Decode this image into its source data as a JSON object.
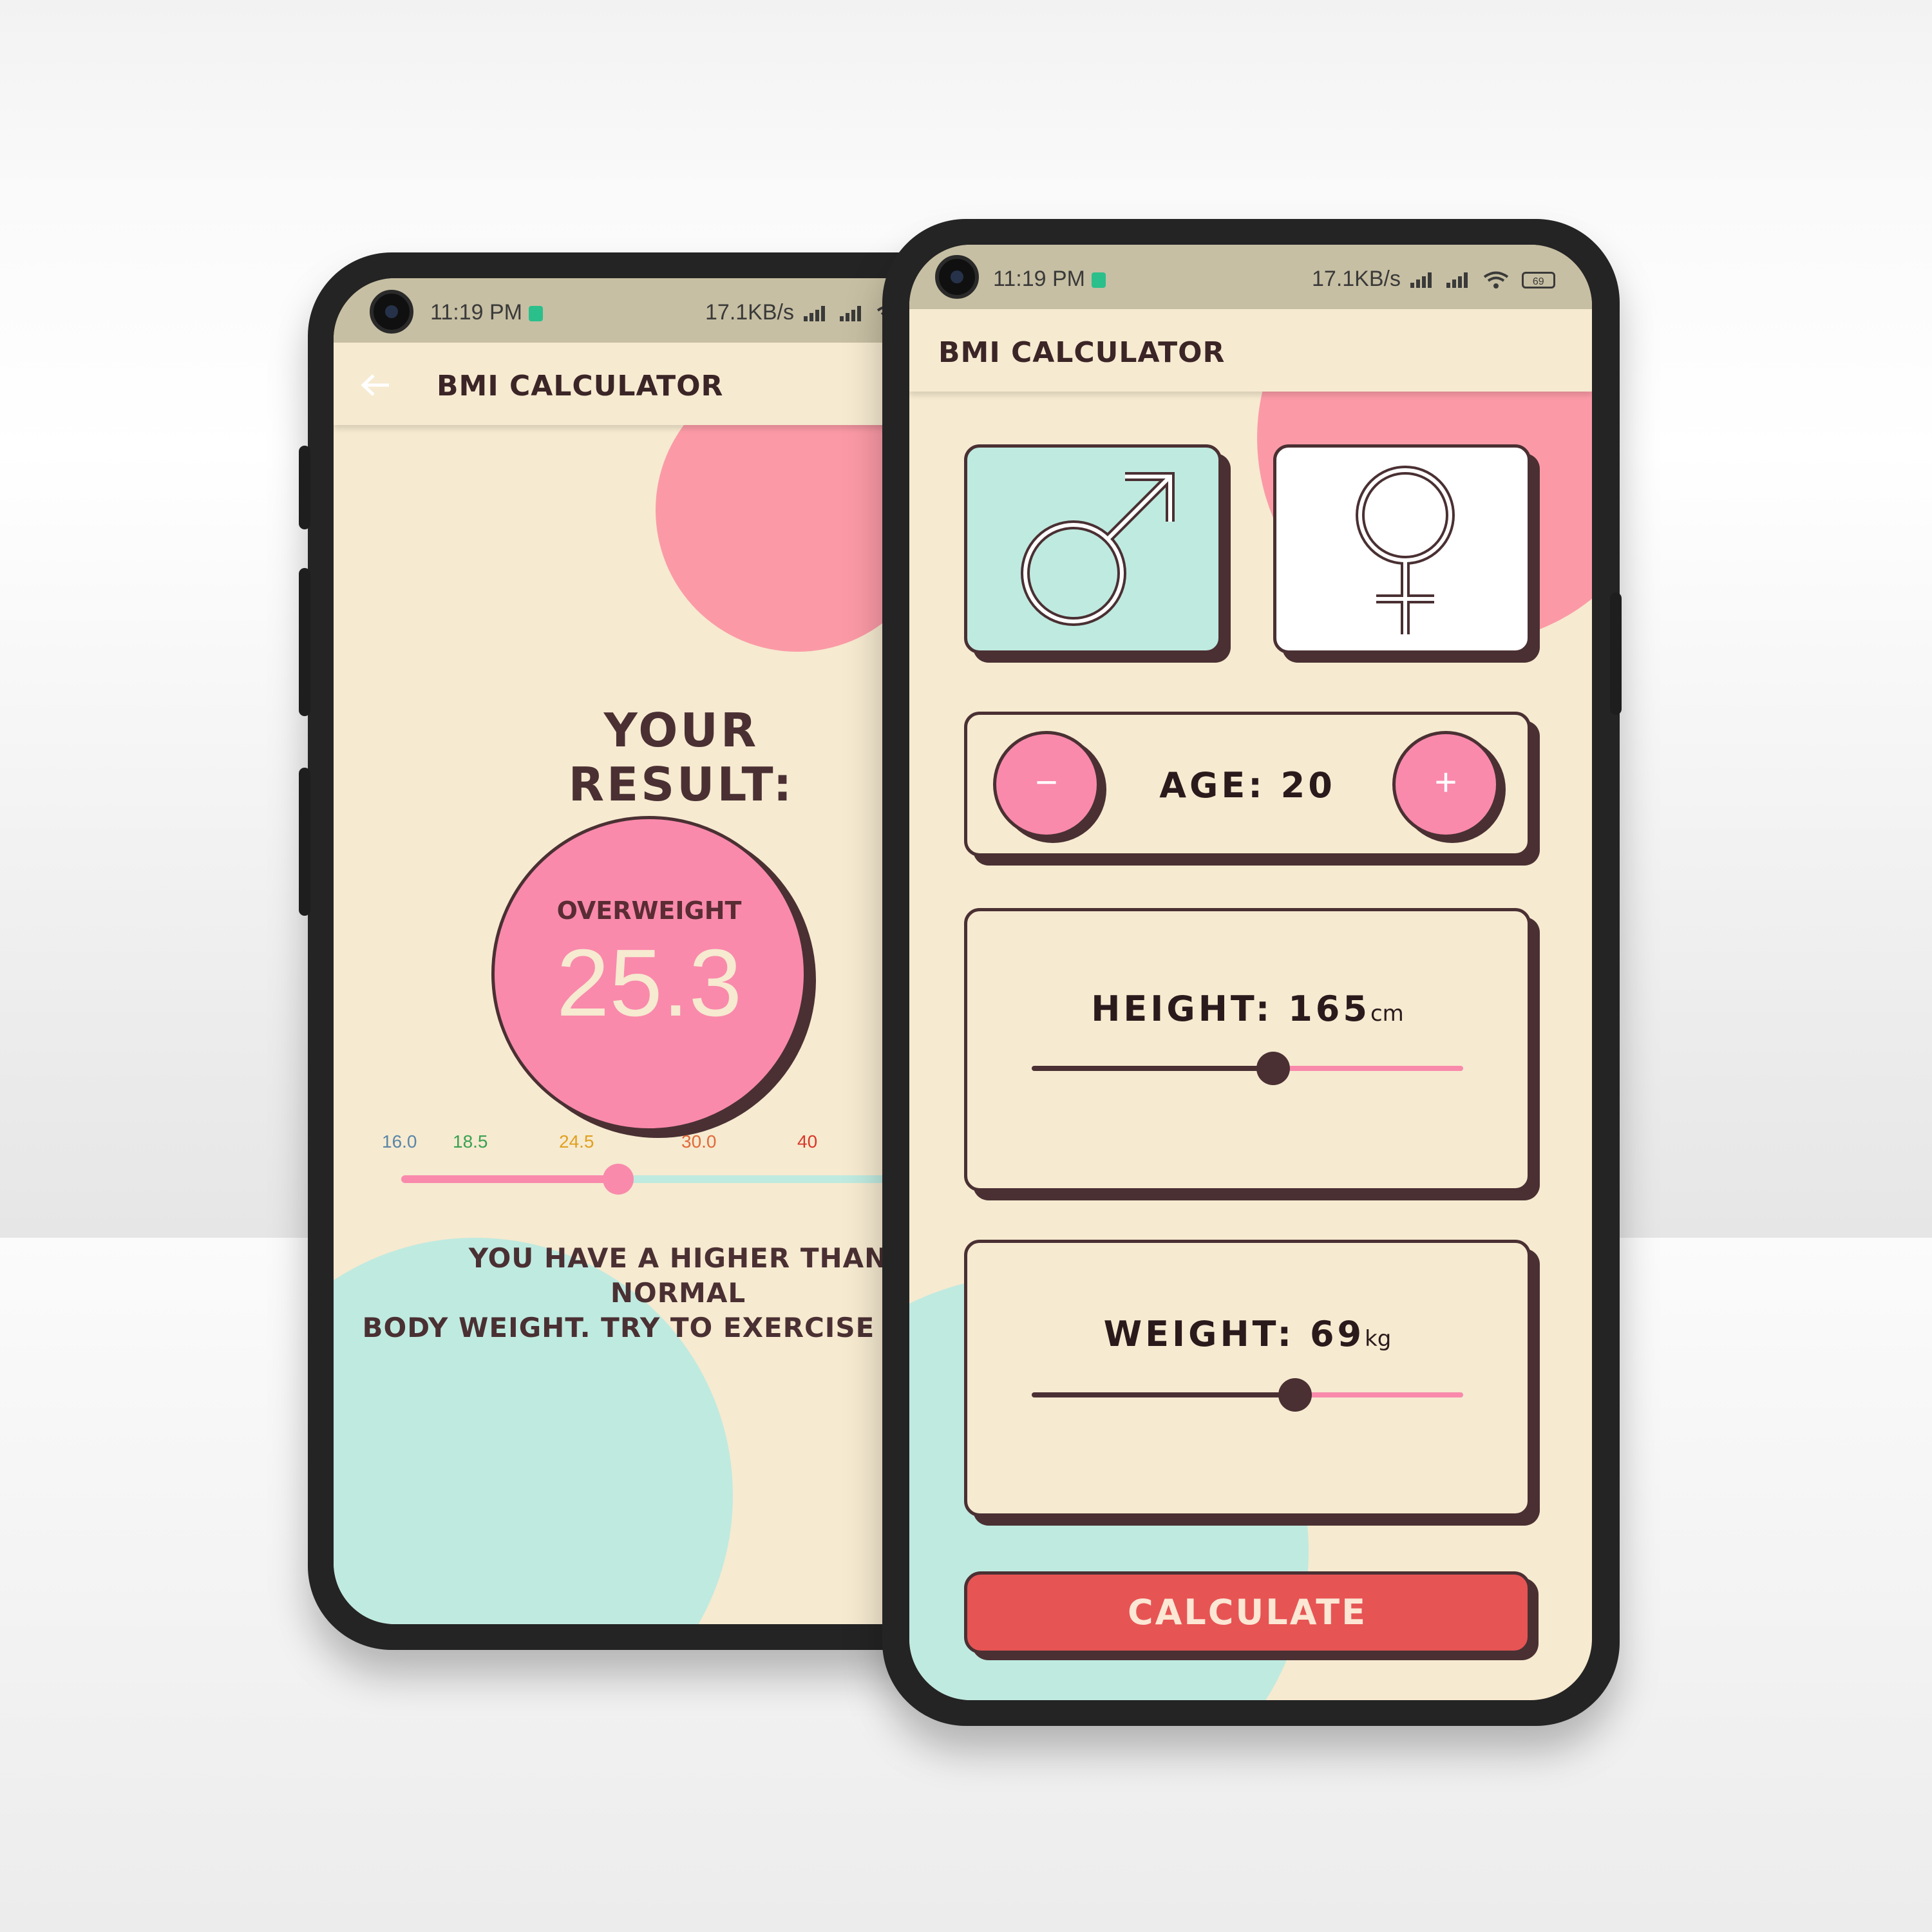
{
  "status_bar": {
    "time": "11:19 PM",
    "network_speed": "17.1KB/s",
    "battery": "69"
  },
  "app": {
    "title": "BMI CALCULATOR"
  },
  "result_screen": {
    "heading": "YOUR RESULT:",
    "status": "OVERWEIGHT",
    "bmi_value": "25.3",
    "scale_labels": [
      {
        "text": "16.0",
        "color": "#5a86a8"
      },
      {
        "text": "18.5",
        "color": "#3aa152"
      },
      {
        "text": "24.5",
        "color": "#e0a020"
      },
      {
        "text": "30.0",
        "color": "#e06a3a"
      },
      {
        "text": "40",
        "color": "#d9382a"
      }
    ],
    "scale_position_fraction": 0.4,
    "message_line1": "YOU HAVE A HIGHER THAN NORMAL",
    "message_line2": "BODY WEIGHT. TRY TO EXERCISE MO"
  },
  "input_screen": {
    "gender": {
      "male_icon": "male-symbol-icon",
      "female_icon": "female-symbol-icon",
      "selected": "male"
    },
    "age": {
      "label": "AGE:",
      "value": "20",
      "minus": "−",
      "plus": "+"
    },
    "height": {
      "label": "HEIGHT:",
      "value": "165",
      "unit": "cm",
      "slider_fraction": 0.56
    },
    "weight": {
      "label": "WEIGHT:",
      "value": "69",
      "unit": "kg",
      "slider_fraction": 0.61
    },
    "calculate_label": "CALCULATE"
  },
  "colors": {
    "background": "#f6ead0",
    "pink": "#f98aac",
    "mint": "#bfeae0",
    "dark_brown": "#4a3033",
    "calculate_red": "#e75454"
  }
}
